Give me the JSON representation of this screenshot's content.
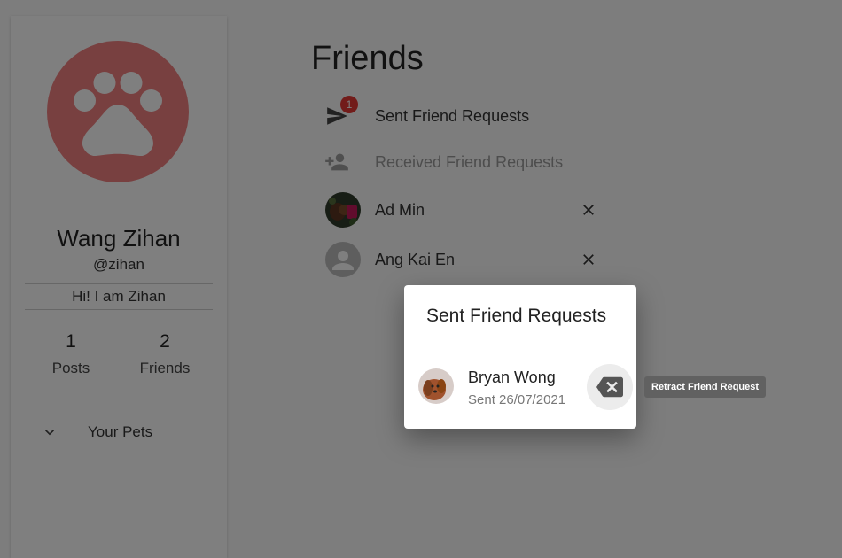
{
  "profile": {
    "name": "Wang Zihan",
    "handle": "@zihan",
    "bio": "Hi! I am Zihan",
    "avatar_icon": "paw-icon",
    "avatar_color": "#f08080",
    "stats": [
      {
        "value": "1",
        "label": "Posts"
      },
      {
        "value": "2",
        "label": "Friends"
      }
    ],
    "pets_label": "Your Pets"
  },
  "main": {
    "title": "Friends",
    "nav": [
      {
        "label": "Sent Friend Requests",
        "icon": "send-icon",
        "badge": "1"
      },
      {
        "label": "Received Friend Requests",
        "icon": "person-add-icon"
      }
    ],
    "friends": [
      {
        "name": "Ad Min",
        "remove_icon": "close-icon"
      },
      {
        "name": "Ang Kai En",
        "remove_icon": "close-icon"
      }
    ]
  },
  "dialog": {
    "title": "Sent Friend Requests",
    "requests": [
      {
        "name": "Bryan Wong",
        "sent": "Sent 26/07/2021",
        "action_icon": "backspace-icon"
      }
    ],
    "tooltip": "Retract Friend Request"
  },
  "colors": {
    "badge": "#e53935",
    "overlay": "rgba(0,0,0,0.5)",
    "tooltip": "#616161"
  }
}
